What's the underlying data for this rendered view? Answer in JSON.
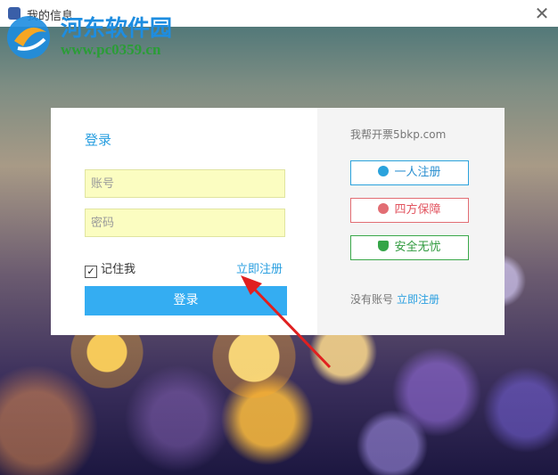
{
  "window": {
    "title": "我的信息"
  },
  "watermark": {
    "title": "河东软件园",
    "url": "www.pc0359.cn"
  },
  "login": {
    "heading": "登录",
    "account_placeholder": "账号",
    "password_placeholder": "密码",
    "remember_label": "记住我",
    "remember_checked": true,
    "register_link": "立即注册",
    "submit_label": "登录"
  },
  "promo": {
    "title": "我帮开票5bkp.com",
    "features": [
      {
        "label": "一人注册",
        "icon": "user-icon",
        "color": "#2aa2dc"
      },
      {
        "label": "四方保障",
        "icon": "guarantee-icon",
        "color": "#e26d73"
      },
      {
        "label": "安全无忧",
        "icon": "shield-icon",
        "color": "#35a548"
      }
    ],
    "no_account_text": "没有账号",
    "no_account_link": "立即注册"
  }
}
